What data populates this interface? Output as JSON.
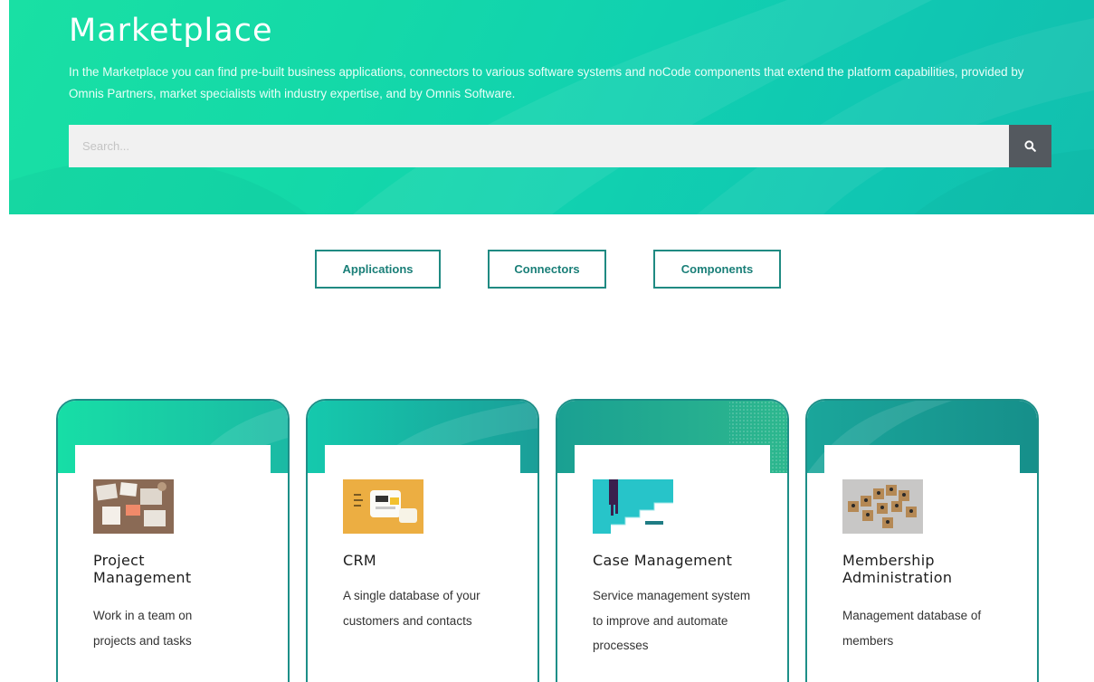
{
  "hero": {
    "title": "Marketplace",
    "description": "In the Marketplace you can find pre-built business applications, connectors to various software systems and noCode components that extend the platform capabilities, provided by Omnis Partners, market specialists with industry expertise, and by Omnis Software.",
    "search_placeholder": "Search...",
    "search_icon": "search-icon"
  },
  "categories": [
    {
      "label": "Applications"
    },
    {
      "label": "Connectors"
    },
    {
      "label": "Components"
    }
  ],
  "cards": [
    {
      "title_line1": "Project",
      "title_line2": "Management",
      "desc": "Work in a team on projects and tasks"
    },
    {
      "title_line1": "CRM",
      "title_line2": "",
      "desc": "A single database of your customers and contacts"
    },
    {
      "title_line1": "Case Management",
      "title_line2": "",
      "desc": "Service management system to improve and automate processes"
    },
    {
      "title_line1": "Membership",
      "title_line2": "Administration",
      "desc": "Management database of members"
    }
  ],
  "colors": {
    "accent": "#1d8f88",
    "hero_start": "#19e0a4",
    "hero_end": "#12bfae",
    "search_button": "#54595f"
  }
}
